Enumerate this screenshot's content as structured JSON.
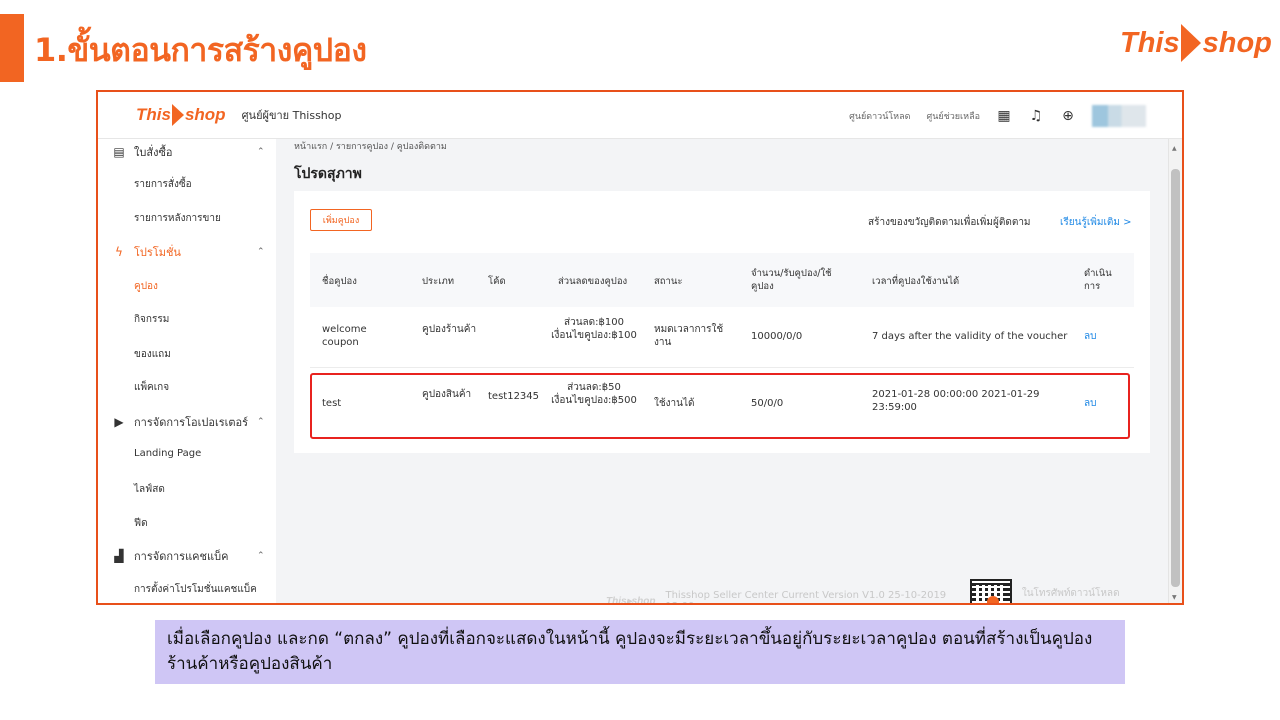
{
  "slide": {
    "title": "1.ขั้นตอนการสร้างคูปอง",
    "brand_this": "This",
    "brand_shop": "shop",
    "note": "เมื่อเลือกคูปอง และกด “ตกลง” คูปองที่เลือกจะแสดงในหน้านี้ คูปองจะมีระยะเวลาขึ้นอยู่กับระยะเวลาคูปอง ตอนที่สร้างเป็นคูปองร้านค้าหรือคูปองสินค้า",
    "accent_color": "#f26522",
    "note_bg": "#cfc6f5"
  },
  "app": {
    "brand_this": "This",
    "brand_shop": "shop",
    "seller_center": "ศูนย์ผู้ขาย Thisshop",
    "top_links": [
      "ศูนย์ดาวน์โหลด",
      "ศูนย์ช่วยเหลือ"
    ],
    "icons": [
      "qr-code-icon",
      "bell-icon",
      "globe-icon"
    ]
  },
  "sidebar": {
    "groups": [
      {
        "label": "ใบสั่งซื้อ",
        "icon": "list-icon"
      },
      {
        "label": "โปรโมชั่น",
        "icon": "lightning-icon"
      },
      {
        "label": "การจัดการโอเปอเรเตอร์",
        "icon": "play-box-icon"
      },
      {
        "label": "การจัดการแคชแบ็ค",
        "icon": "chart-icon"
      }
    ],
    "items": [
      "รายการสั่งซื้อ",
      "รายการหลังการขาย",
      "คูปอง",
      "กิจกรรม",
      "ของแถม",
      "แพ็คเกจ",
      "Landing Page",
      "ไลฟ์สด",
      "ฟีด",
      "การตั้งค่าโปรโมชั่นแคชแบ็ค"
    ]
  },
  "main": {
    "breadcrumb": "หน้าแรก / รายการคูปอง / คูปองติดตาม",
    "heading": "โปรดสุภาพ",
    "add_button": "เพิ่มคูปอง",
    "follow_text": "สร้างของขวัญติดตามเพื่อเพิ่มผู้ติดตาม",
    "learn_more": "เรียนรู้เพิ่มเติม >",
    "columns": [
      "ชื่อคูปอง",
      "ประเภท",
      "โค้ด",
      "ส่วนลดของคูปอง",
      "สถานะ",
      "จำนวน/รับคูปอง/ใช้คูปอง",
      "เวลาที่คูปองใช้งานได้",
      "ดำเนินการ"
    ],
    "rows": [
      {
        "name": "welcome coupon",
        "type": "คูปองร้านค้า",
        "code": "",
        "discount": "ส่วนลด:฿100 เงื่อนไขคูปอง:฿100",
        "status": "หมดเวลาการใช้งาน",
        "quantity": "10000/0/0",
        "period": "7 days after the validity of the voucher",
        "action": "ลบ"
      },
      {
        "name": "test",
        "type": "คูปองสินค้า",
        "code": "test12345",
        "discount": "ส่วนลด:฿50 เงื่อนไขคูปอง:฿500",
        "status": "ใช้งานได้",
        "quantity": "50/0/0",
        "period": "2021-01-28 00:00:00 2021-01-29 23:59:00",
        "action": "ลบ"
      }
    ]
  },
  "footer": {
    "brand_this": "This",
    "brand_shop": "shop",
    "text": "Thisshop Seller Center   Current Version V1.0   25-10-2019 12:00",
    "download_text": "ในโทรศัพท์ดาวน์โหลดแอปพลิเคชัน"
  }
}
